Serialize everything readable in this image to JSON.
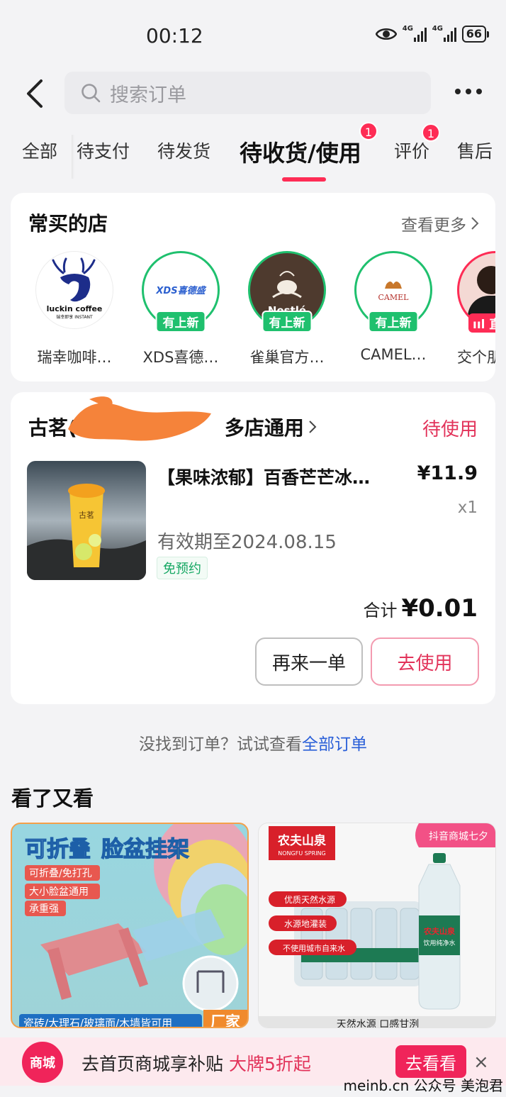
{
  "status_bar": {
    "time": "00:12",
    "net1": "4G",
    "net2": "4G",
    "battery": "66"
  },
  "header": {
    "search_placeholder": "搜索订单"
  },
  "tabs": [
    {
      "label": "全部",
      "badge": ""
    },
    {
      "label": "待支付",
      "badge": ""
    },
    {
      "label": "待发货",
      "badge": ""
    },
    {
      "label": "待收货/使用",
      "badge": "1"
    },
    {
      "label": "评价",
      "badge": "1"
    },
    {
      "label": "售后",
      "badge": ""
    }
  ],
  "shops_section": {
    "title": "常买的店",
    "more": "查看更多",
    "shops": [
      {
        "name": "瑞幸咖啡…",
        "logo_text": "luckin coffee",
        "logo_sub": "瑞幸即享 INSTANT",
        "tag": ""
      },
      {
        "name": "XDS喜德…",
        "logo_text": "XDS喜德盛",
        "tag": "有上新"
      },
      {
        "name": "雀巢官方…",
        "logo_text": "Nestlé",
        "tag": "有上新"
      },
      {
        "name": "CAMEL…",
        "logo_text": "CAMEL",
        "tag": "有上新"
      },
      {
        "name": "交个朋",
        "logo_text": "",
        "tag": "直"
      }
    ]
  },
  "order": {
    "shop_prefix": "古茗(",
    "shop_suffix": "多店通用",
    "status": "待使用",
    "product_title": "【果味浓郁】百香芒芒冰…",
    "price": "¥11.9",
    "qty": "x1",
    "valid": "有效期至2024.08.15",
    "tag": "免预约",
    "total_label": "合计",
    "total_value": "¥0.01",
    "btn_again": "再来一单",
    "btn_use": "去使用",
    "cup_brand": "古茗"
  },
  "not_found": {
    "text": "没找到订单？试试查看",
    "link": "全部订单"
  },
  "recommend": {
    "title": "看了又看",
    "item1": {
      "headline_a": "可折叠",
      "headline_b": "脸盆挂架",
      "points": [
        "可折叠/免打孔",
        "大小脸盆通用",
        "承重强"
      ],
      "footer": "瓷砖/大理石/玻璃面/木墙皆可用",
      "corner": "厂家"
    },
    "item2": {
      "brand": "农夫山泉",
      "brand_en": "NONGFU SPRING",
      "mall_tag": "抖音商城七夕",
      "points": [
        "优质天然水源",
        "水源地灌装",
        "不使用城市自来水"
      ],
      "bottle_label": "农夫山泉",
      "bottle_sub": "饮用纯净水",
      "footer": "天然水源 口感甘洌"
    }
  },
  "banner": {
    "icon_text": "商城",
    "text": "去首页商城享补贴",
    "highlight": "大牌5折起",
    "button": "去看看",
    "close": "×"
  },
  "watermark": "meinb.cn 公众号 美泡君"
}
